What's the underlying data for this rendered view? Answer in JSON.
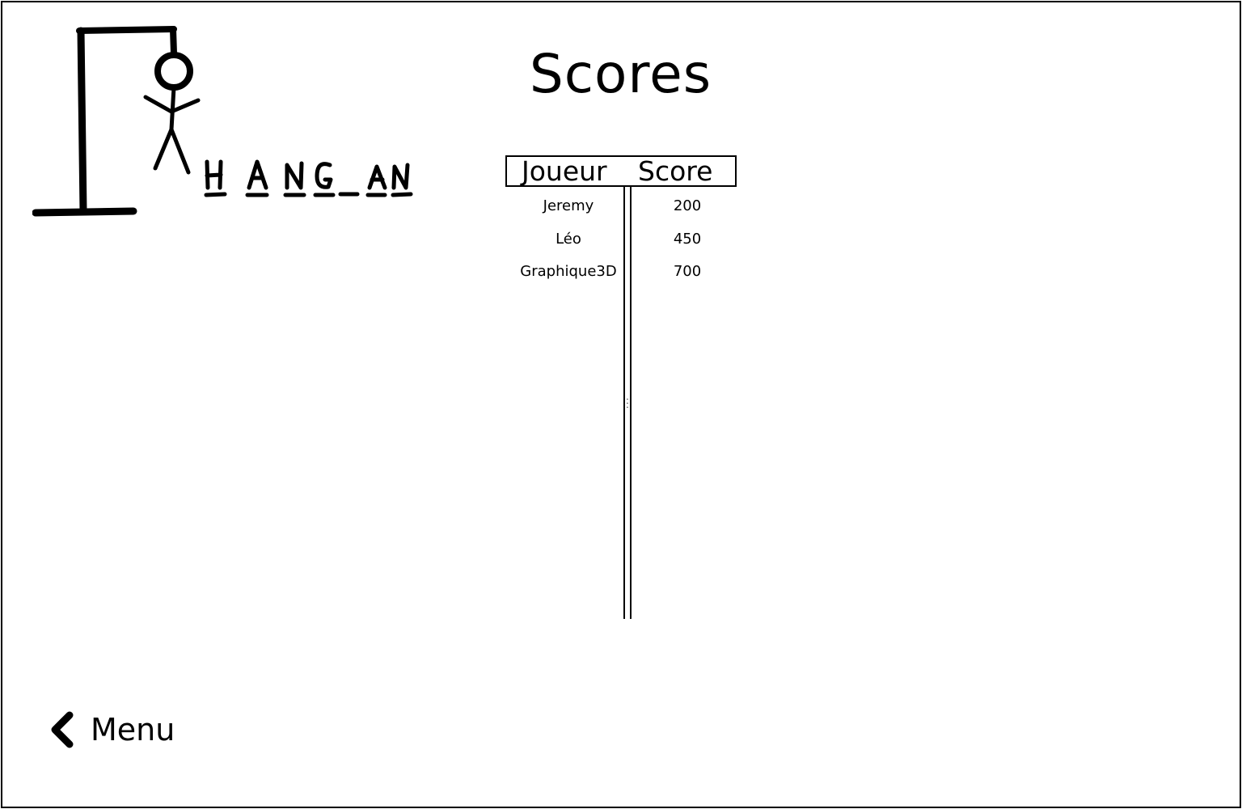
{
  "app": {
    "logo_text": "HANG_AN"
  },
  "page": {
    "title": "Scores"
  },
  "scores_table": {
    "columns": [
      "Joueur",
      "Score"
    ],
    "rows": [
      {
        "player": "Jeremy",
        "score": "200"
      },
      {
        "player": "Léo",
        "score": "450"
      },
      {
        "player": "Graphique3D",
        "score": "700"
      }
    ]
  },
  "navigation": {
    "back_label": "Menu",
    "back_icon": "chevron-left-icon"
  }
}
